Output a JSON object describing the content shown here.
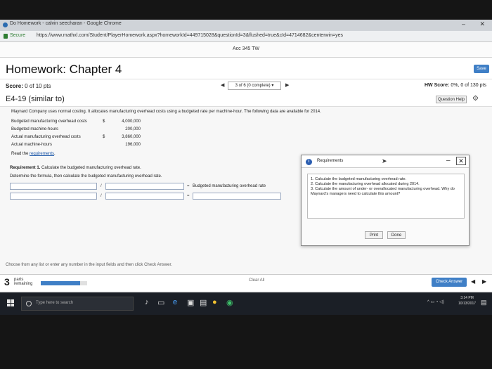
{
  "browser": {
    "tab_title": "Do Homework - calvin seecharan - Google Chrome",
    "secure_label": "Secure",
    "url": "https://www.mathxl.com/Student/PlayerHomework.aspx?homeworkId=449715028&questionId=3&flushed=true&cId=4714682&centerwin=yes",
    "min_glyph": "–",
    "close_glyph": "✕"
  },
  "course": {
    "title": "Acc 345 TW"
  },
  "header": {
    "title": "Homework: Chapter 4",
    "save_label": "Save"
  },
  "score": {
    "label": "Score:",
    "value": "0 of 10 pts",
    "question_select": "3 of 6 (0 complete) ▾",
    "hw_score_label": "HW Score:",
    "hw_score_value": "0%, 0 of 130 pts",
    "prev_glyph": "◀",
    "next_glyph": "▶"
  },
  "question": {
    "id": "E4-19 (similar to)",
    "help_label": "Question Help",
    "intro": "Maynard Company uses normal costing. It allocates manufacturing overhead costs using a budgeted rate per machine-hour. The following data are available for 2014.",
    "data": [
      {
        "label": "Budgeted manufacturing overhead costs",
        "dollar": "$",
        "value": "4,000,000"
      },
      {
        "label": "Budgeted machine-hours",
        "dollar": "",
        "value": "200,000"
      },
      {
        "label": "Actual manufacturing overhead costs",
        "dollar": "$",
        "value": "3,860,000"
      },
      {
        "label": "Actual machine-hours",
        "dollar": "",
        "value": "196,000"
      }
    ],
    "read_prefix": "Read the ",
    "read_link": "requirements",
    "read_suffix": ".",
    "req1_bold": "Requirement 1.",
    "req1_text": " Calculate the budgeted manufacturing overhead rate.",
    "formula_instruction": "Determine the formula, then calculate the budgeted manufacturing overhead rate.",
    "divide_op": "/",
    "equals_op": "=",
    "result_label": "Budgeted manufacturing overhead rate"
  },
  "requirements_panel": {
    "title": "Requirements",
    "items": [
      "1. Calculate the budgeted manufacturing overhead rate.",
      "2. Calculate the manufacturing overhead allocated during 2014.",
      "3. Calculate the amount of under- or overallocated manufacturing overhead. Why do Maynard's managers need to calculate this amount?"
    ],
    "print_label": "Print",
    "done_label": "Done"
  },
  "footer": {
    "instruction": "Choose from any list or enter any number in the input fields and then click Check Answer.",
    "parts_count": "3",
    "parts_label_1": "parts",
    "parts_label_2": "remaining",
    "progress_fraction": 0.85,
    "clear_all_label": "Clear All",
    "check_answer_label": "Check Answer"
  },
  "taskbar": {
    "search_placeholder": "Type here to search",
    "time": "3:14 PM",
    "date": "10/13/2017"
  },
  "colors": {
    "accent": "#3f7fc6",
    "link": "#1a56a8",
    "taskbar": "#1b1f26"
  }
}
